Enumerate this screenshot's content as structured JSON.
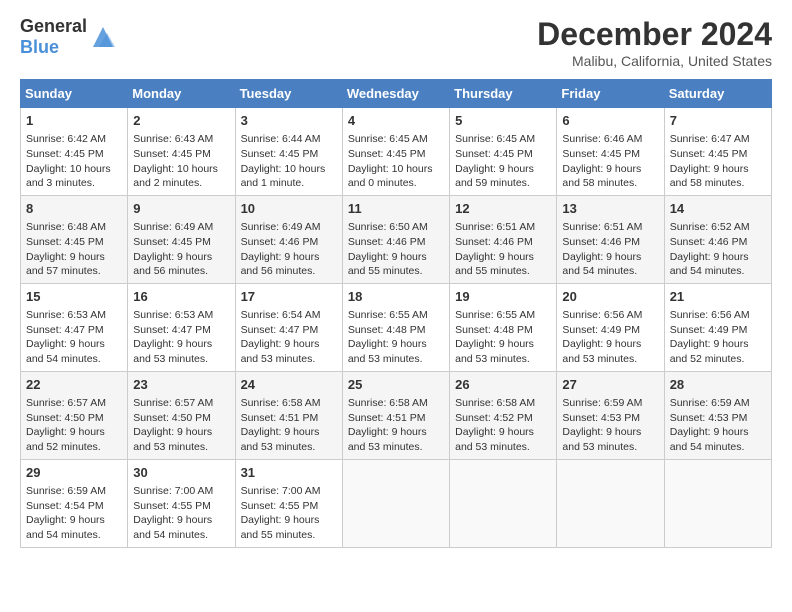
{
  "header": {
    "logo_general": "General",
    "logo_blue": "Blue",
    "month_title": "December 2024",
    "location": "Malibu, California, United States"
  },
  "weekdays": [
    "Sunday",
    "Monday",
    "Tuesday",
    "Wednesday",
    "Thursday",
    "Friday",
    "Saturday"
  ],
  "weeks": [
    [
      {
        "day": "1",
        "lines": [
          "Sunrise: 6:42 AM",
          "Sunset: 4:45 PM",
          "Daylight: 10 hours",
          "and 3 minutes."
        ]
      },
      {
        "day": "2",
        "lines": [
          "Sunrise: 6:43 AM",
          "Sunset: 4:45 PM",
          "Daylight: 10 hours",
          "and 2 minutes."
        ]
      },
      {
        "day": "3",
        "lines": [
          "Sunrise: 6:44 AM",
          "Sunset: 4:45 PM",
          "Daylight: 10 hours",
          "and 1 minute."
        ]
      },
      {
        "day": "4",
        "lines": [
          "Sunrise: 6:45 AM",
          "Sunset: 4:45 PM",
          "Daylight: 10 hours",
          "and 0 minutes."
        ]
      },
      {
        "day": "5",
        "lines": [
          "Sunrise: 6:45 AM",
          "Sunset: 4:45 PM",
          "Daylight: 9 hours",
          "and 59 minutes."
        ]
      },
      {
        "day": "6",
        "lines": [
          "Sunrise: 6:46 AM",
          "Sunset: 4:45 PM",
          "Daylight: 9 hours",
          "and 58 minutes."
        ]
      },
      {
        "day": "7",
        "lines": [
          "Sunrise: 6:47 AM",
          "Sunset: 4:45 PM",
          "Daylight: 9 hours",
          "and 58 minutes."
        ]
      }
    ],
    [
      {
        "day": "8",
        "lines": [
          "Sunrise: 6:48 AM",
          "Sunset: 4:45 PM",
          "Daylight: 9 hours",
          "and 57 minutes."
        ]
      },
      {
        "day": "9",
        "lines": [
          "Sunrise: 6:49 AM",
          "Sunset: 4:45 PM",
          "Daylight: 9 hours",
          "and 56 minutes."
        ]
      },
      {
        "day": "10",
        "lines": [
          "Sunrise: 6:49 AM",
          "Sunset: 4:46 PM",
          "Daylight: 9 hours",
          "and 56 minutes."
        ]
      },
      {
        "day": "11",
        "lines": [
          "Sunrise: 6:50 AM",
          "Sunset: 4:46 PM",
          "Daylight: 9 hours",
          "and 55 minutes."
        ]
      },
      {
        "day": "12",
        "lines": [
          "Sunrise: 6:51 AM",
          "Sunset: 4:46 PM",
          "Daylight: 9 hours",
          "and 55 minutes."
        ]
      },
      {
        "day": "13",
        "lines": [
          "Sunrise: 6:51 AM",
          "Sunset: 4:46 PM",
          "Daylight: 9 hours",
          "and 54 minutes."
        ]
      },
      {
        "day": "14",
        "lines": [
          "Sunrise: 6:52 AM",
          "Sunset: 4:46 PM",
          "Daylight: 9 hours",
          "and 54 minutes."
        ]
      }
    ],
    [
      {
        "day": "15",
        "lines": [
          "Sunrise: 6:53 AM",
          "Sunset: 4:47 PM",
          "Daylight: 9 hours",
          "and 54 minutes."
        ]
      },
      {
        "day": "16",
        "lines": [
          "Sunrise: 6:53 AM",
          "Sunset: 4:47 PM",
          "Daylight: 9 hours",
          "and 53 minutes."
        ]
      },
      {
        "day": "17",
        "lines": [
          "Sunrise: 6:54 AM",
          "Sunset: 4:47 PM",
          "Daylight: 9 hours",
          "and 53 minutes."
        ]
      },
      {
        "day": "18",
        "lines": [
          "Sunrise: 6:55 AM",
          "Sunset: 4:48 PM",
          "Daylight: 9 hours",
          "and 53 minutes."
        ]
      },
      {
        "day": "19",
        "lines": [
          "Sunrise: 6:55 AM",
          "Sunset: 4:48 PM",
          "Daylight: 9 hours",
          "and 53 minutes."
        ]
      },
      {
        "day": "20",
        "lines": [
          "Sunrise: 6:56 AM",
          "Sunset: 4:49 PM",
          "Daylight: 9 hours",
          "and 53 minutes."
        ]
      },
      {
        "day": "21",
        "lines": [
          "Sunrise: 6:56 AM",
          "Sunset: 4:49 PM",
          "Daylight: 9 hours",
          "and 52 minutes."
        ]
      }
    ],
    [
      {
        "day": "22",
        "lines": [
          "Sunrise: 6:57 AM",
          "Sunset: 4:50 PM",
          "Daylight: 9 hours",
          "and 52 minutes."
        ]
      },
      {
        "day": "23",
        "lines": [
          "Sunrise: 6:57 AM",
          "Sunset: 4:50 PM",
          "Daylight: 9 hours",
          "and 53 minutes."
        ]
      },
      {
        "day": "24",
        "lines": [
          "Sunrise: 6:58 AM",
          "Sunset: 4:51 PM",
          "Daylight: 9 hours",
          "and 53 minutes."
        ]
      },
      {
        "day": "25",
        "lines": [
          "Sunrise: 6:58 AM",
          "Sunset: 4:51 PM",
          "Daylight: 9 hours",
          "and 53 minutes."
        ]
      },
      {
        "day": "26",
        "lines": [
          "Sunrise: 6:58 AM",
          "Sunset: 4:52 PM",
          "Daylight: 9 hours",
          "and 53 minutes."
        ]
      },
      {
        "day": "27",
        "lines": [
          "Sunrise: 6:59 AM",
          "Sunset: 4:53 PM",
          "Daylight: 9 hours",
          "and 53 minutes."
        ]
      },
      {
        "day": "28",
        "lines": [
          "Sunrise: 6:59 AM",
          "Sunset: 4:53 PM",
          "Daylight: 9 hours",
          "and 54 minutes."
        ]
      }
    ],
    [
      {
        "day": "29",
        "lines": [
          "Sunrise: 6:59 AM",
          "Sunset: 4:54 PM",
          "Daylight: 9 hours",
          "and 54 minutes."
        ]
      },
      {
        "day": "30",
        "lines": [
          "Sunrise: 7:00 AM",
          "Sunset: 4:55 PM",
          "Daylight: 9 hours",
          "and 54 minutes."
        ]
      },
      {
        "day": "31",
        "lines": [
          "Sunrise: 7:00 AM",
          "Sunset: 4:55 PM",
          "Daylight: 9 hours",
          "and 55 minutes."
        ]
      },
      null,
      null,
      null,
      null
    ]
  ]
}
